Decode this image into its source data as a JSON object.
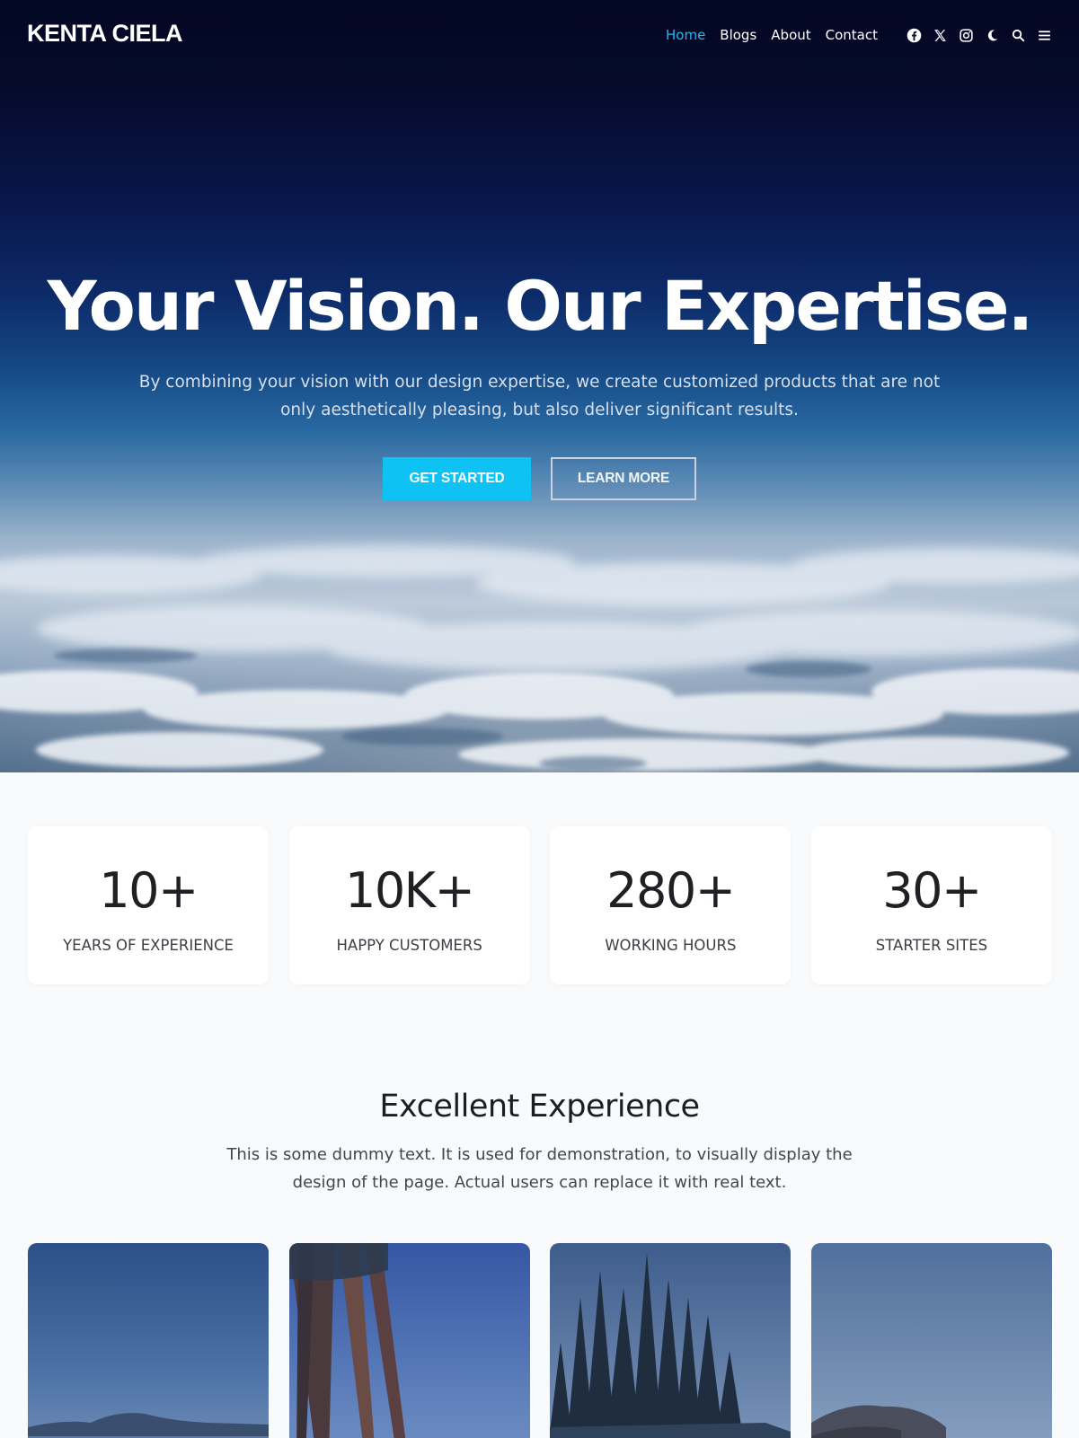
{
  "brand": {
    "logo": "KENTA CIELA"
  },
  "nav": {
    "links": [
      {
        "label": "Home",
        "active": true
      },
      {
        "label": "Blogs",
        "active": false
      },
      {
        "label": "About",
        "active": false
      },
      {
        "label": "Contact",
        "active": false
      }
    ],
    "icons": [
      "facebook-icon",
      "x-twitter-icon",
      "instagram-icon",
      "moon-icon",
      "search-icon",
      "menu-icon"
    ],
    "accent_color": "#22b8f5"
  },
  "hero": {
    "title": "Your Vision. Our Expertise.",
    "subtitle": "By combining your vision with our design expertise, we create customized products that are not only aesthetically pleasing, but also deliver significant results.",
    "primary_button": "GET STARTED",
    "secondary_button": "LEARN MORE",
    "primary_color": "#0ec3f3"
  },
  "stats": [
    {
      "value": "10+",
      "label": "YEARS OF EXPERIENCE"
    },
    {
      "value": "10K+",
      "label": "HAPPY CUSTOMERS"
    },
    {
      "value": "280+",
      "label": "WORKING HOURS"
    },
    {
      "value": "30+",
      "label": "STARTER SITES"
    }
  ],
  "section": {
    "title": "Excellent Experience",
    "description": "This is some dummy text. It is used for demonstration, to visually display the design of the page. Actual users can replace it with real text."
  },
  "gallery": [
    {
      "image": "mountain-lake"
    },
    {
      "image": "pine-trunks"
    },
    {
      "image": "forest-island"
    },
    {
      "image": "coastal-cliff"
    }
  ]
}
